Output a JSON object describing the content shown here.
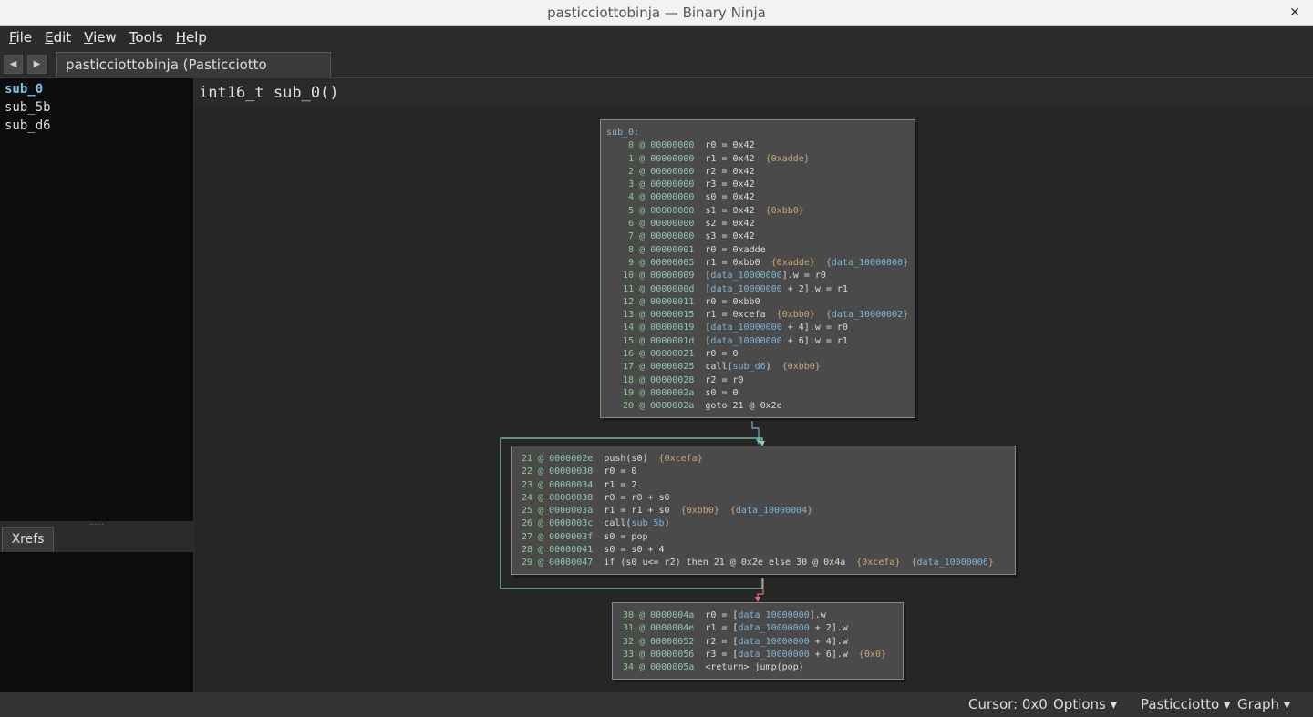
{
  "window": {
    "title": "pasticciottobinja — Binary Ninja",
    "close": "✕"
  },
  "menu": [
    {
      "label": "File",
      "key": "F",
      "rest": "ile"
    },
    {
      "label": "Edit",
      "key": "E",
      "rest": "dit"
    },
    {
      "label": "View",
      "key": "V",
      "rest": "iew"
    },
    {
      "label": "Tools",
      "key": "T",
      "rest": "ools"
    },
    {
      "label": "Help",
      "key": "H",
      "rest": "elp"
    }
  ],
  "nav": {
    "back_icon": "◀",
    "forward_icon": "▶"
  },
  "tab": {
    "label": "pasticciottobinja (Pasticciotto Graph)",
    "close": "⛝"
  },
  "functions": [
    "sub_0",
    "sub_5b",
    "sub_d6"
  ],
  "active_function": "sub_0",
  "xrefs": {
    "tab": "Xrefs"
  },
  "header": {
    "signature": "int16_t sub_0()"
  },
  "colors": {
    "symbol": "#7fb6d6",
    "annotation": "#c9a87a",
    "index": "#8fc98f",
    "true_edge": "#8fd4a8",
    "false_edge": "#d9707f",
    "unconditional_edge": "#6ab0d8"
  },
  "blocks": [
    {
      "label": "sub_0:",
      "lines": [
        [
          "0",
          "00000000",
          [
            [
              "t",
              "r0 = 0x42"
            ]
          ]
        ],
        [
          "1",
          "00000000",
          [
            [
              "t",
              "r1 = 0x42  "
            ],
            [
              "a",
              "{0xadde}"
            ]
          ]
        ],
        [
          "2",
          "00000000",
          [
            [
              "t",
              "r2 = 0x42"
            ]
          ]
        ],
        [
          "3",
          "00000000",
          [
            [
              "t",
              "r3 = 0x42"
            ]
          ]
        ],
        [
          "4",
          "00000000",
          [
            [
              "t",
              "s0 = 0x42"
            ]
          ]
        ],
        [
          "5",
          "00000000",
          [
            [
              "t",
              "s1 = 0x42  "
            ],
            [
              "a",
              "{0xbb0}"
            ]
          ]
        ],
        [
          "6",
          "00000000",
          [
            [
              "t",
              "s2 = 0x42"
            ]
          ]
        ],
        [
          "7",
          "00000000",
          [
            [
              "t",
              "s3 = 0x42"
            ]
          ]
        ],
        [
          "8",
          "00000001",
          [
            [
              "t",
              "r0 = 0xadde"
            ]
          ]
        ],
        [
          "9",
          "00000005",
          [
            [
              "t",
              "r1 = 0xbb0  "
            ],
            [
              "a",
              "{0xadde}"
            ],
            [
              "t",
              "  "
            ],
            [
              "a",
              "{"
            ],
            [
              "s",
              "data_10000000"
            ],
            [
              "a",
              "}"
            ]
          ]
        ],
        [
          "10",
          "00000009",
          [
            [
              "t",
              "["
            ],
            [
              "s",
              "data_10000000"
            ],
            [
              "t",
              "].w = r0"
            ]
          ]
        ],
        [
          "11",
          "0000000d",
          [
            [
              "t",
              "["
            ],
            [
              "s",
              "data_10000000"
            ],
            [
              "t",
              " + 2].w = r1"
            ]
          ]
        ],
        [
          "12",
          "00000011",
          [
            [
              "t",
              "r0 = 0xbb0"
            ]
          ]
        ],
        [
          "13",
          "00000015",
          [
            [
              "t",
              "r1 = 0xcefa  "
            ],
            [
              "a",
              "{0xbb0}"
            ],
            [
              "t",
              "  "
            ],
            [
              "a",
              "{"
            ],
            [
              "s",
              "data_10000002"
            ],
            [
              "a",
              "}"
            ]
          ]
        ],
        [
          "14",
          "00000019",
          [
            [
              "t",
              "["
            ],
            [
              "s",
              "data_10000000"
            ],
            [
              "t",
              " + 4].w = r0"
            ]
          ]
        ],
        [
          "15",
          "0000001d",
          [
            [
              "t",
              "["
            ],
            [
              "s",
              "data_10000000"
            ],
            [
              "t",
              " + 6].w = r1"
            ]
          ]
        ],
        [
          "16",
          "00000021",
          [
            [
              "t",
              "r0 = 0"
            ]
          ]
        ],
        [
          "17",
          "00000025",
          [
            [
              "t",
              "call("
            ],
            [
              "s",
              "sub_d6"
            ],
            [
              "t",
              ")  "
            ],
            [
              "a",
              "{0xbb0}"
            ]
          ]
        ],
        [
          "18",
          "00000028",
          [
            [
              "t",
              "r2 = r0"
            ]
          ]
        ],
        [
          "19",
          "0000002a",
          [
            [
              "t",
              "s0 = 0"
            ]
          ]
        ],
        [
          "20",
          "0000002a",
          [
            [
              "t",
              "goto 21 @ 0x2e"
            ]
          ]
        ]
      ]
    },
    {
      "label": "",
      "lines": [
        [
          "21",
          "0000002e",
          [
            [
              "t",
              "push(s0)  "
            ],
            [
              "a",
              "{0xcefa}"
            ]
          ]
        ],
        [
          "22",
          "00000030",
          [
            [
              "t",
              "r0 = 0"
            ]
          ]
        ],
        [
          "23",
          "00000034",
          [
            [
              "t",
              "r1 = 2"
            ]
          ]
        ],
        [
          "24",
          "00000038",
          [
            [
              "t",
              "r0 = r0 + s0"
            ]
          ]
        ],
        [
          "25",
          "0000003a",
          [
            [
              "t",
              "r1 = r1 + s0  "
            ],
            [
              "a",
              "{0xbb0}"
            ],
            [
              "t",
              "  "
            ],
            [
              "a",
              "{"
            ],
            [
              "s",
              "data_10000004"
            ],
            [
              "a",
              "}"
            ]
          ]
        ],
        [
          "26",
          "0000003c",
          [
            [
              "t",
              "call("
            ],
            [
              "s",
              "sub_5b"
            ],
            [
              "t",
              ")"
            ]
          ]
        ],
        [
          "27",
          "0000003f",
          [
            [
              "t",
              "s0 = pop"
            ]
          ]
        ],
        [
          "28",
          "00000041",
          [
            [
              "t",
              "s0 = s0 + 4"
            ]
          ]
        ],
        [
          "29",
          "00000047",
          [
            [
              "t",
              "if (s0 u<= r2) then 21 @ 0x2e else 30 @ 0x4a  "
            ],
            [
              "a",
              "{0xcefa}"
            ],
            [
              "t",
              "  "
            ],
            [
              "a",
              "{"
            ],
            [
              "s",
              "data_10000006"
            ],
            [
              "a",
              "}"
            ]
          ]
        ]
      ]
    },
    {
      "label": "",
      "lines": [
        [
          "30",
          "0000004a",
          [
            [
              "t",
              "r0 = ["
            ],
            [
              "s",
              "data_10000000"
            ],
            [
              "t",
              "].w"
            ]
          ]
        ],
        [
          "31",
          "0000004e",
          [
            [
              "t",
              "r1 = ["
            ],
            [
              "s",
              "data_10000000"
            ],
            [
              "t",
              " + 2].w"
            ]
          ]
        ],
        [
          "32",
          "00000052",
          [
            [
              "t",
              "r2 = ["
            ],
            [
              "s",
              "data_10000000"
            ],
            [
              "t",
              " + 4].w"
            ]
          ]
        ],
        [
          "33",
          "00000056",
          [
            [
              "t",
              "r3 = ["
            ],
            [
              "s",
              "data_10000000"
            ],
            [
              "t",
              " + 6].w  "
            ],
            [
              "a",
              "{0x0}"
            ]
          ]
        ],
        [
          "34",
          "0000005a",
          [
            [
              "t",
              "<return> jump(pop)"
            ]
          ]
        ]
      ]
    }
  ],
  "status": {
    "cursor": "Cursor: 0x0",
    "options": "Options ▾",
    "architecture": "Pasticciotto ▾",
    "view": "Graph ▾"
  }
}
